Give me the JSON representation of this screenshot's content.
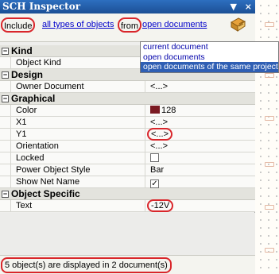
{
  "panel": {
    "title": "SCH Inspector",
    "title_controls": [
      "▼",
      "×"
    ]
  },
  "filter": {
    "include_label": "Include",
    "types_link": "all types of objects",
    "from_label": "from",
    "scope_link": "open documents",
    "scope_options": [
      "current document",
      "open documents",
      "open documents of the same project"
    ],
    "scope_selected_index": 2
  },
  "categories": {
    "kind": {
      "label": "Kind",
      "rows": [
        {
          "name": "Object Kind",
          "value": ""
        }
      ]
    },
    "design": {
      "label": "Design",
      "rows": [
        {
          "name": "Owner Document",
          "value": "<...>"
        }
      ]
    },
    "graphical": {
      "label": "Graphical",
      "color_value": "128",
      "color_swatch": "#7b1a22",
      "x1": "<...>",
      "y1": "<...>",
      "orientation": "<...>",
      "locked_checked": false,
      "power_object_style": "Bar",
      "show_net_name_checked": true,
      "names": {
        "color": "Color",
        "x1": "X1",
        "y1": "Y1",
        "orientation": "Orientation",
        "locked": "Locked",
        "power_object_style": "Power Object Style",
        "show_net_name": "Show Net Name"
      }
    },
    "object_specific": {
      "label": "Object Specific",
      "text_name": "Text",
      "text_value": "-12V"
    }
  },
  "status": {
    "text": "5 object(s) are displayed in 2 document(s)"
  },
  "colors": {
    "title_bar": "#1f5aa6",
    "highlight_oval": "#d9262b",
    "selection": "#2f5fb4"
  }
}
